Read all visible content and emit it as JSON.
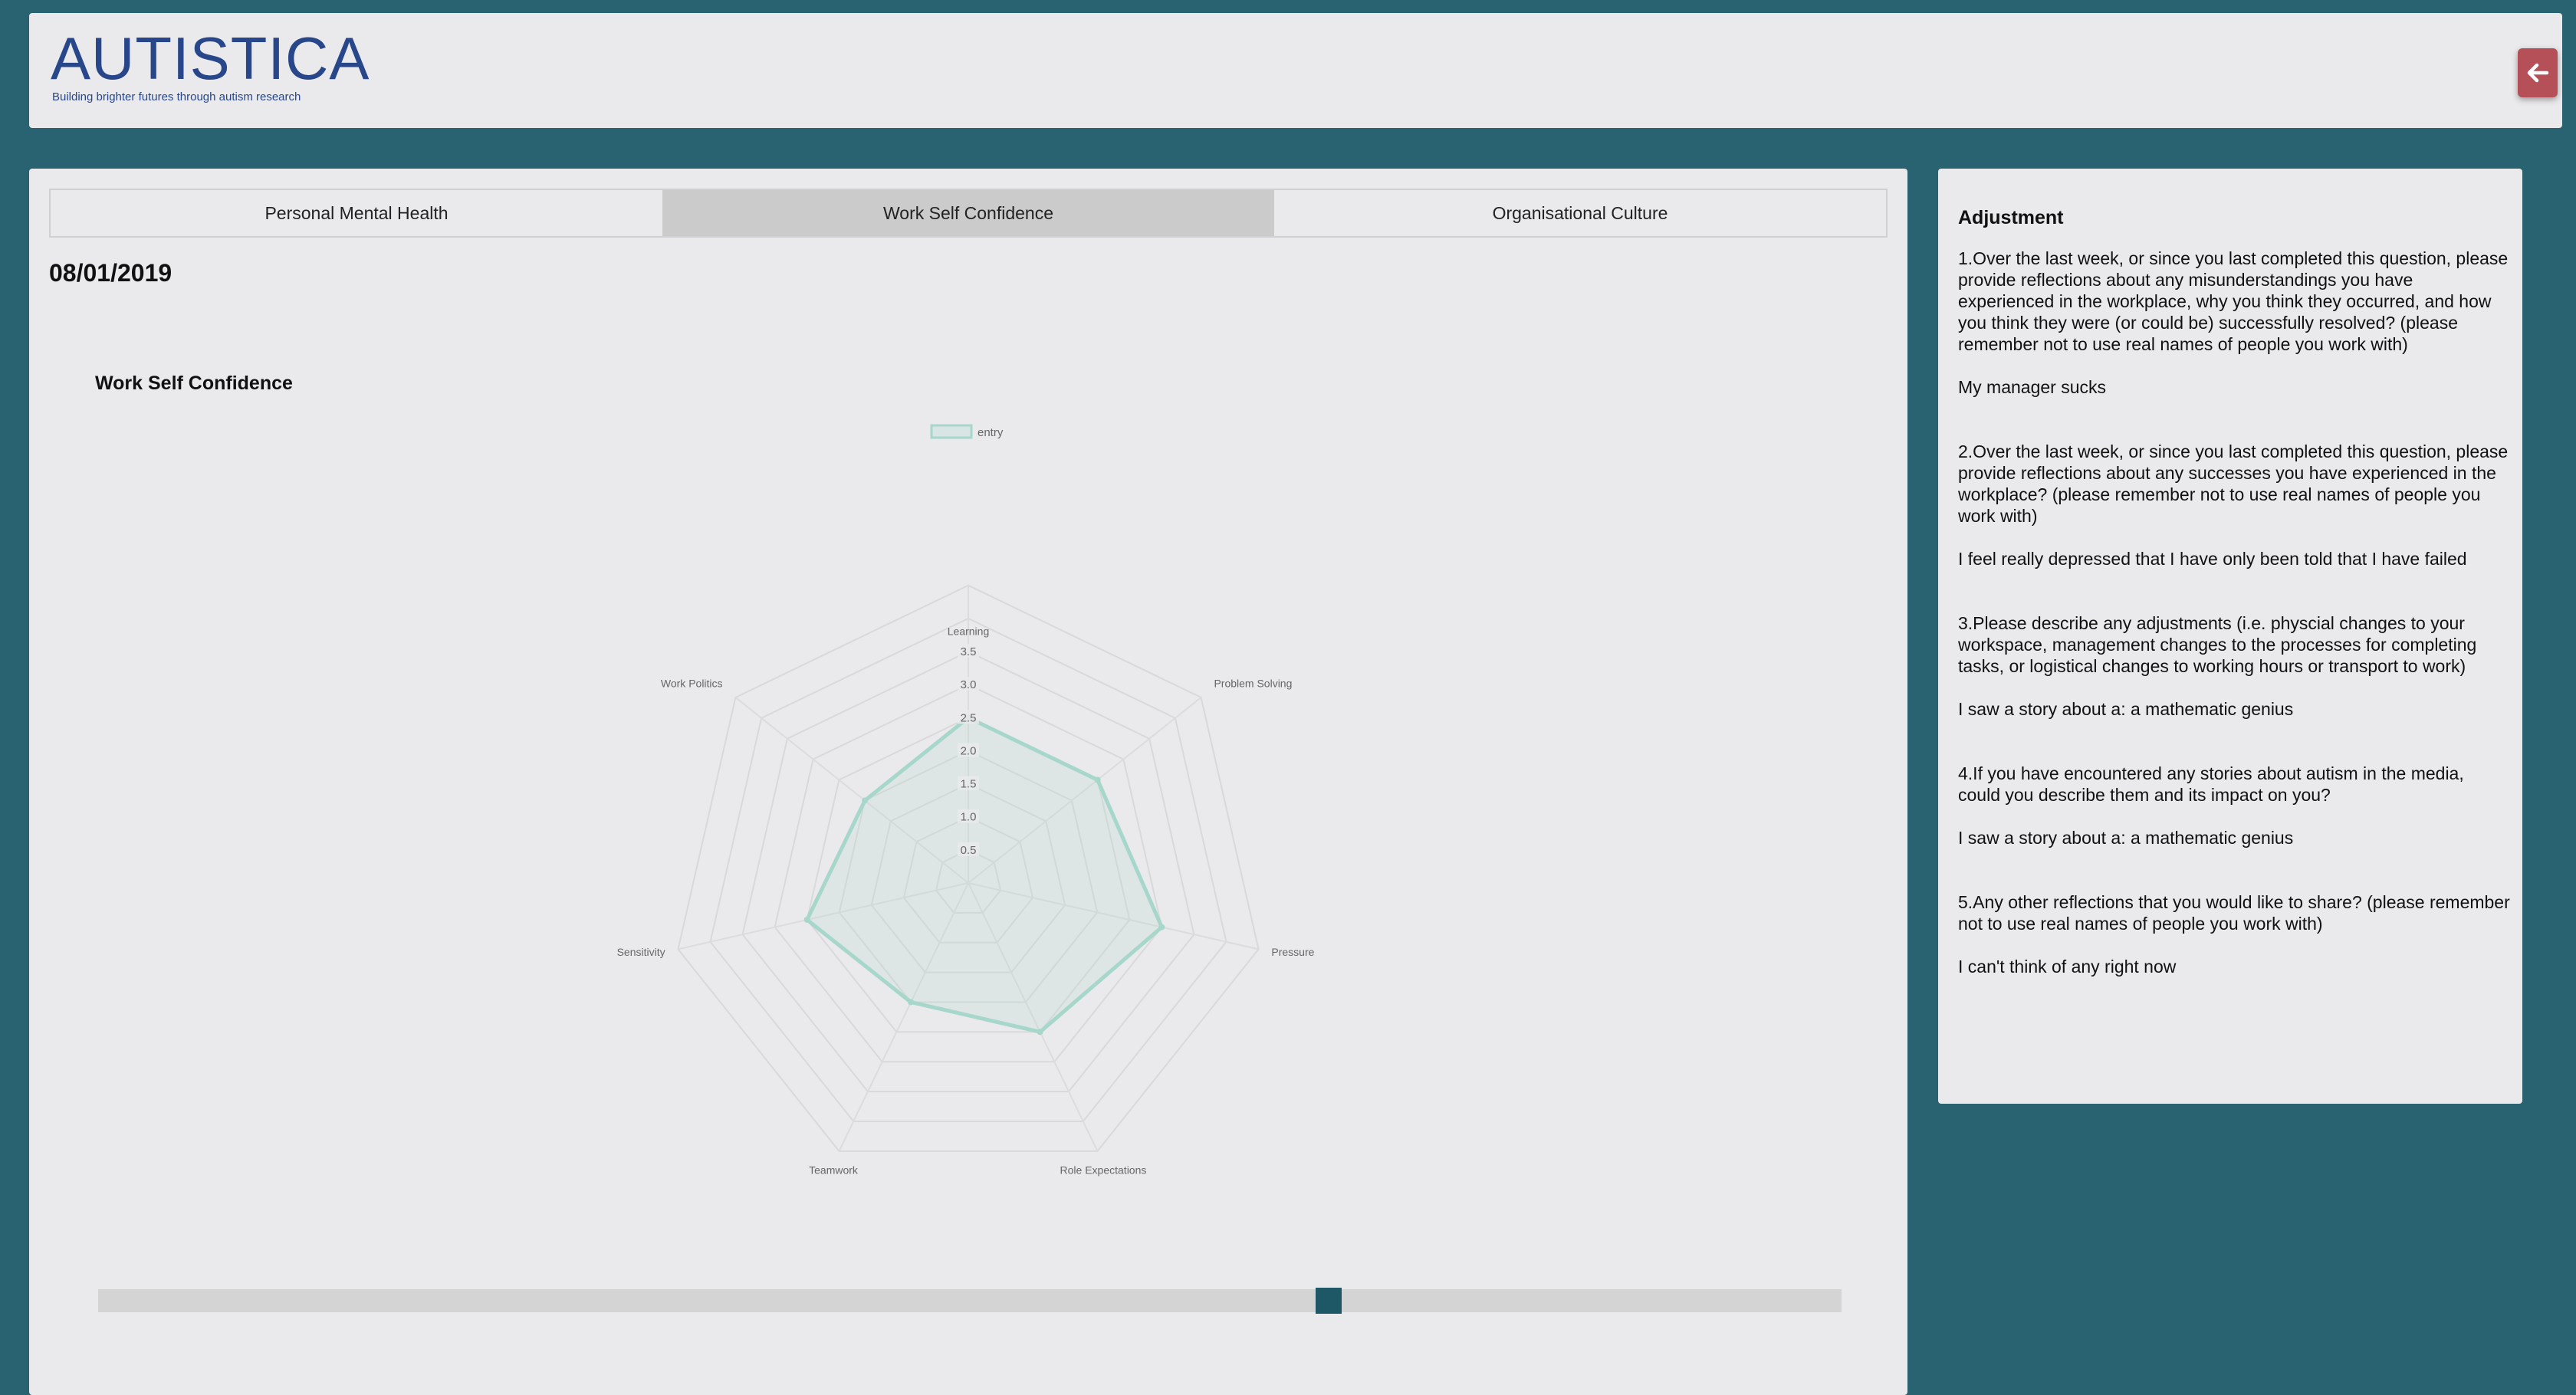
{
  "header": {
    "logo_title": "AUTISTICA",
    "logo_tagline": "Building brighter futures through autism research",
    "back_icon": "arrow-left-icon",
    "accent_color": "#b55058"
  },
  "tabs": [
    {
      "label": "Personal Mental Health",
      "active": false
    },
    {
      "label": "Work Self Confidence",
      "active": true
    },
    {
      "label": "Organisational Culture",
      "active": false
    }
  ],
  "entry_date": "08/01/2019",
  "chart_data": {
    "type": "radar",
    "title": "Work Self Confidence",
    "categories": [
      "Learning",
      "Problem Solving",
      "Pressure",
      "Role Expectations",
      "Teamwork",
      "Sensitivity",
      "Work Politics"
    ],
    "series": [
      {
        "name": "entry",
        "values": [
          2.5,
          2.5,
          3.0,
          2.5,
          2.0,
          2.5,
          2.0
        ],
        "color": "#a6d7ca"
      }
    ],
    "ticks": [
      "0.5",
      "1.0",
      "1.5",
      "2.0",
      "2.5",
      "3.0",
      "3.5"
    ],
    "rlim": [
      0,
      3.5
    ],
    "legend": "top",
    "grid": true
  },
  "slider": {
    "value_fraction": 0.71
  },
  "adjustment": {
    "title": "Adjustment",
    "items": [
      {
        "question": "1.Over the last week, or since you last completed this question, please provide reflections about any misunderstandings you have experienced in the workplace, why you think they occurred, and how you think they were (or could be) successfully resolved? (please remember not to use real names of people you work with)",
        "answer": "My manager sucks"
      },
      {
        "question": "2.Over the last week, or since you last completed this question, please provide reflections about any successes you have experienced in the workplace? (please remember not to use real names of people you work with)",
        "answer": "I feel really depressed that I have only been told that I have failed"
      },
      {
        "question": "3.Please describe any adjustments (i.e. physcial changes to your workspace, management changes to the processes for completing tasks, or logistical changes to working hours or transport to work)",
        "answer": "I saw a story about a: a mathematic genius"
      },
      {
        "question": "4.If you have encountered any stories about autism in the media, could you describe them and its impact on you?",
        "answer": "I saw a story about a: a mathematic genius"
      },
      {
        "question": "5.Any other reflections that you would like to share? (please remember not to use real names of people you work with)",
        "answer": "I can't think of any right now"
      }
    ]
  }
}
